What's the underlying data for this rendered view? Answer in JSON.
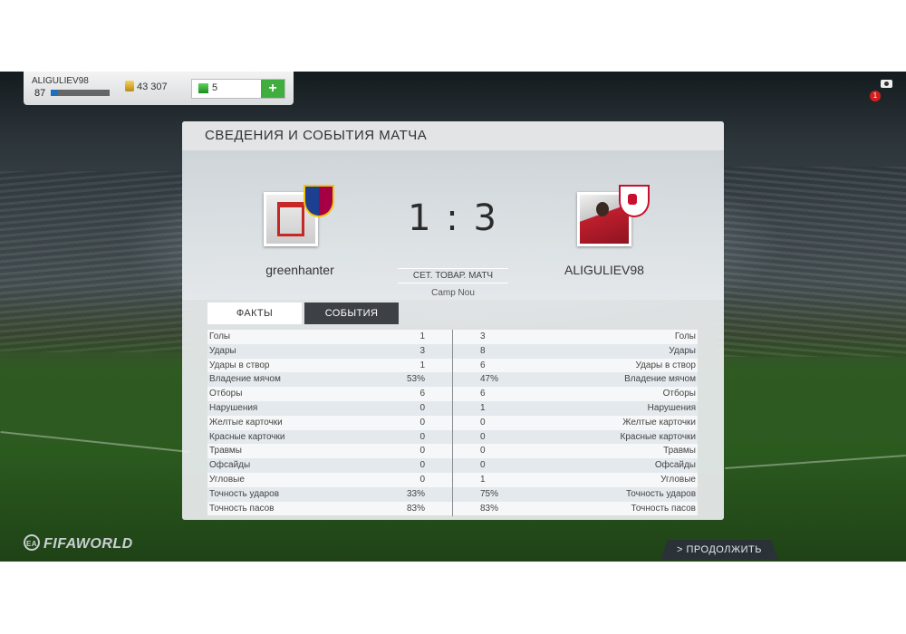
{
  "header": {
    "username": "ALIGULIEV98",
    "level": "87",
    "coins": "43 307",
    "points": "5",
    "add_points_icon": "plus-icon",
    "xp_progress": 0.12
  },
  "panel": {
    "title": "СВЕДЕНИЯ И СОБЫТИЯ МАТЧА",
    "home_team": "greenhanter",
    "away_team": "ALIGULIEV98",
    "score": "1 : 3",
    "match_type": "СЕТ. ТОВАР. МАТЧ",
    "venue": "Camp Nou",
    "tabs": [
      "ФАКТЫ",
      "СОБЫТИЯ"
    ],
    "stats": [
      {
        "label": "Голы",
        "home": "1",
        "away": "3"
      },
      {
        "label": "Удары",
        "home": "3",
        "away": "8"
      },
      {
        "label": "Удары в створ",
        "home": "1",
        "away": "6"
      },
      {
        "label": "Владение мячом",
        "home": "53%",
        "away": "47%"
      },
      {
        "label": "Отборы",
        "home": "6",
        "away": "6"
      },
      {
        "label": "Нарушения",
        "home": "0",
        "away": "1"
      },
      {
        "label": "Желтые карточки",
        "home": "0",
        "away": "0"
      },
      {
        "label": "Красные карточки",
        "home": "0",
        "away": "0"
      },
      {
        "label": "Травмы",
        "home": "0",
        "away": "0"
      },
      {
        "label": "Офсайды",
        "home": "0",
        "away": "0"
      },
      {
        "label": "Угловые",
        "home": "0",
        "away": "1"
      },
      {
        "label": "Точность ударов",
        "home": "33%",
        "away": "75%"
      },
      {
        "label": "Точность пасов",
        "home": "83%",
        "away": "83%"
      }
    ]
  },
  "footer": {
    "logo_ea": "EA",
    "logo_text": "FIFAWORLD",
    "continue_label": "> ПРОДОЛЖИТЬ"
  },
  "notifications": {
    "count": "1",
    "icon": "camera-icon"
  },
  "colors": {
    "accent_green": "#3fae3f",
    "events_tab": "#3d4146",
    "notif_red": "#d21e1e"
  }
}
